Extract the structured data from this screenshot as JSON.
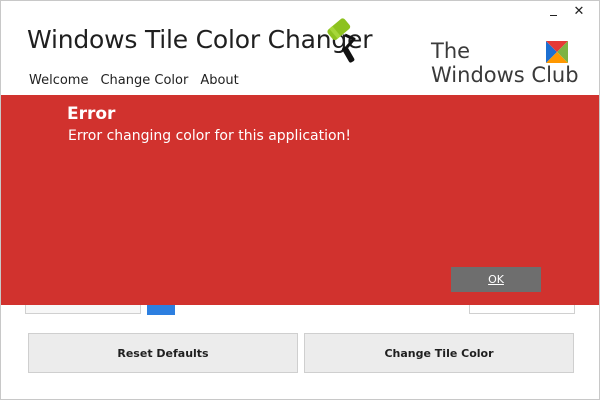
{
  "window": {
    "title": "Windows Tile Color Changer",
    "controls": {
      "minimize_icon": "minimize-icon",
      "close_label": "✕"
    }
  },
  "nav": {
    "items": [
      {
        "label": "Welcome"
      },
      {
        "label": "Change Color"
      },
      {
        "label": "About"
      }
    ]
  },
  "brand": {
    "line1": "The",
    "line2": "Windows Club",
    "icon": "twc-logo-icon"
  },
  "actions": {
    "reset_label": "Reset Defaults",
    "change_label": "Change Tile Color"
  },
  "error_dialog": {
    "title": "Error",
    "message": "Error changing color for this application!",
    "ok_label": "OK"
  },
  "colors": {
    "error_background": "#d1322e",
    "ok_button": "#6e6e6e",
    "accent_blue": "#2d7fe0",
    "roller_green": "#8dc21f"
  }
}
